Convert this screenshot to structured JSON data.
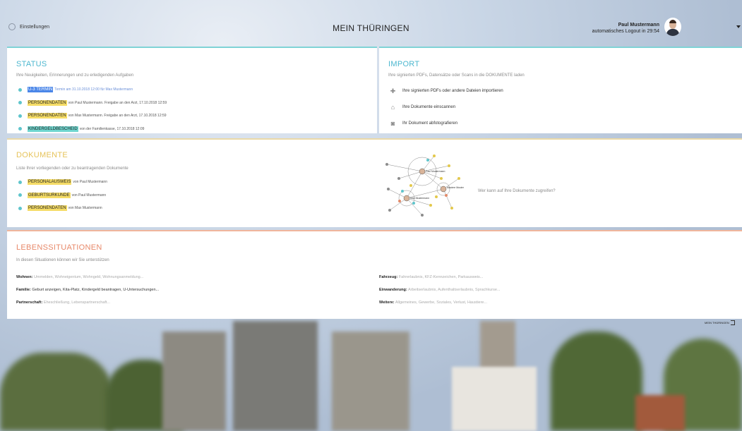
{
  "header": {
    "settings_label": "Einstellungen",
    "app_title": "MEIN THÜRINGEN",
    "user_name": "Paul Mustermann",
    "logout_text": "automatisches Logout in 29:54"
  },
  "status": {
    "title": "STATUS",
    "subtitle": "Ihre Neuigkeiten, Erinnerungen und zu erledigenden Aufgaben",
    "items": [
      {
        "tag": "U-3 TERMIN",
        "text": "Termin am 31.10.2018 12:00 für Max Mustermann",
        "tag_color": "#4a86e8"
      },
      {
        "tag": "PERSONENDATEN",
        "text": "von Paul Mustermann. Freigabe an den Arzt, 17.10.2018 12:59",
        "tag_color": "#f5dc66"
      },
      {
        "tag": "PERSONENDATEN",
        "text": "von Max Mustermann. Freigabe an den Arzt, 17.10.2018 12:59",
        "tag_color": "#f5dc66"
      },
      {
        "tag": "KINDERGELDBESCHEID",
        "text": "von der Familienkasse, 17.10.2018 12:09",
        "tag_color": "#6fd6cf"
      }
    ]
  },
  "import": {
    "title": "IMPORT",
    "subtitle": "Ihre signierten PDFs, Datensätze oder Scans in die DOKUMENTE laden",
    "actions": [
      {
        "icon": "plus-icon",
        "label": "Ihre signierten PDFs oder andere Dateien importieren"
      },
      {
        "icon": "scanner-icon",
        "label": "Ihre Dokumente einscannen"
      },
      {
        "icon": "camera-icon",
        "label": "Ihr Dokument abfotografieren"
      }
    ]
  },
  "dokumente": {
    "title": "DOKUMENTE",
    "subtitle": "Liste Ihrer vorliegenden oder zu beantragenden Dokumente",
    "items": [
      {
        "tag": "PERSONALAUSWEIS",
        "text": "von Paul Mustermann"
      },
      {
        "tag": "GEBURTSURKUNDE",
        "text": "von Paul Mustermann"
      },
      {
        "tag": "PERSONENDATEN",
        "text": "von Max Mustermann"
      }
    ],
    "network_labels": [
      "Paul Mustermann",
      "Maxime Muster",
      "Max Mustermann"
    ],
    "access_question": "Wer kann auf Ihre Dokumente zugreifen?"
  },
  "lebenssituationen": {
    "title": "LEBENSSITUATIONEN",
    "subtitle": "In diesen Situationen können wir Sie unterstützen",
    "left": [
      {
        "label": "Wohnen:",
        "text": "Ummelden, Wohneigentum, Wohngeld, Wohnungsanmeldung..."
      },
      {
        "label": "Familie:",
        "text": "Geburt anzeigen, Kita-Platz, Kindergeld beantragen, U-Untersuchungen..."
      },
      {
        "label": "Partnerschaft:",
        "text": "Eheschließung, Lebenspartnerschaft..."
      }
    ],
    "right": [
      {
        "label": "Fahrzeug:",
        "text": "Fahrerlaubnis, KFZ-Kennzeichen, Parkausweis..."
      },
      {
        "label": "Einwanderung:",
        "text": "Arbeitserlaubnis, Aufenthaltserlaubnis, Sprachkurse..."
      },
      {
        "label": "Weitere:",
        "text": "Allgemeines, Gewerbe, Soziales, Verlust, Haustiere..."
      }
    ]
  },
  "footer": {
    "logo_text": "MEIN THÜRINGEN"
  }
}
